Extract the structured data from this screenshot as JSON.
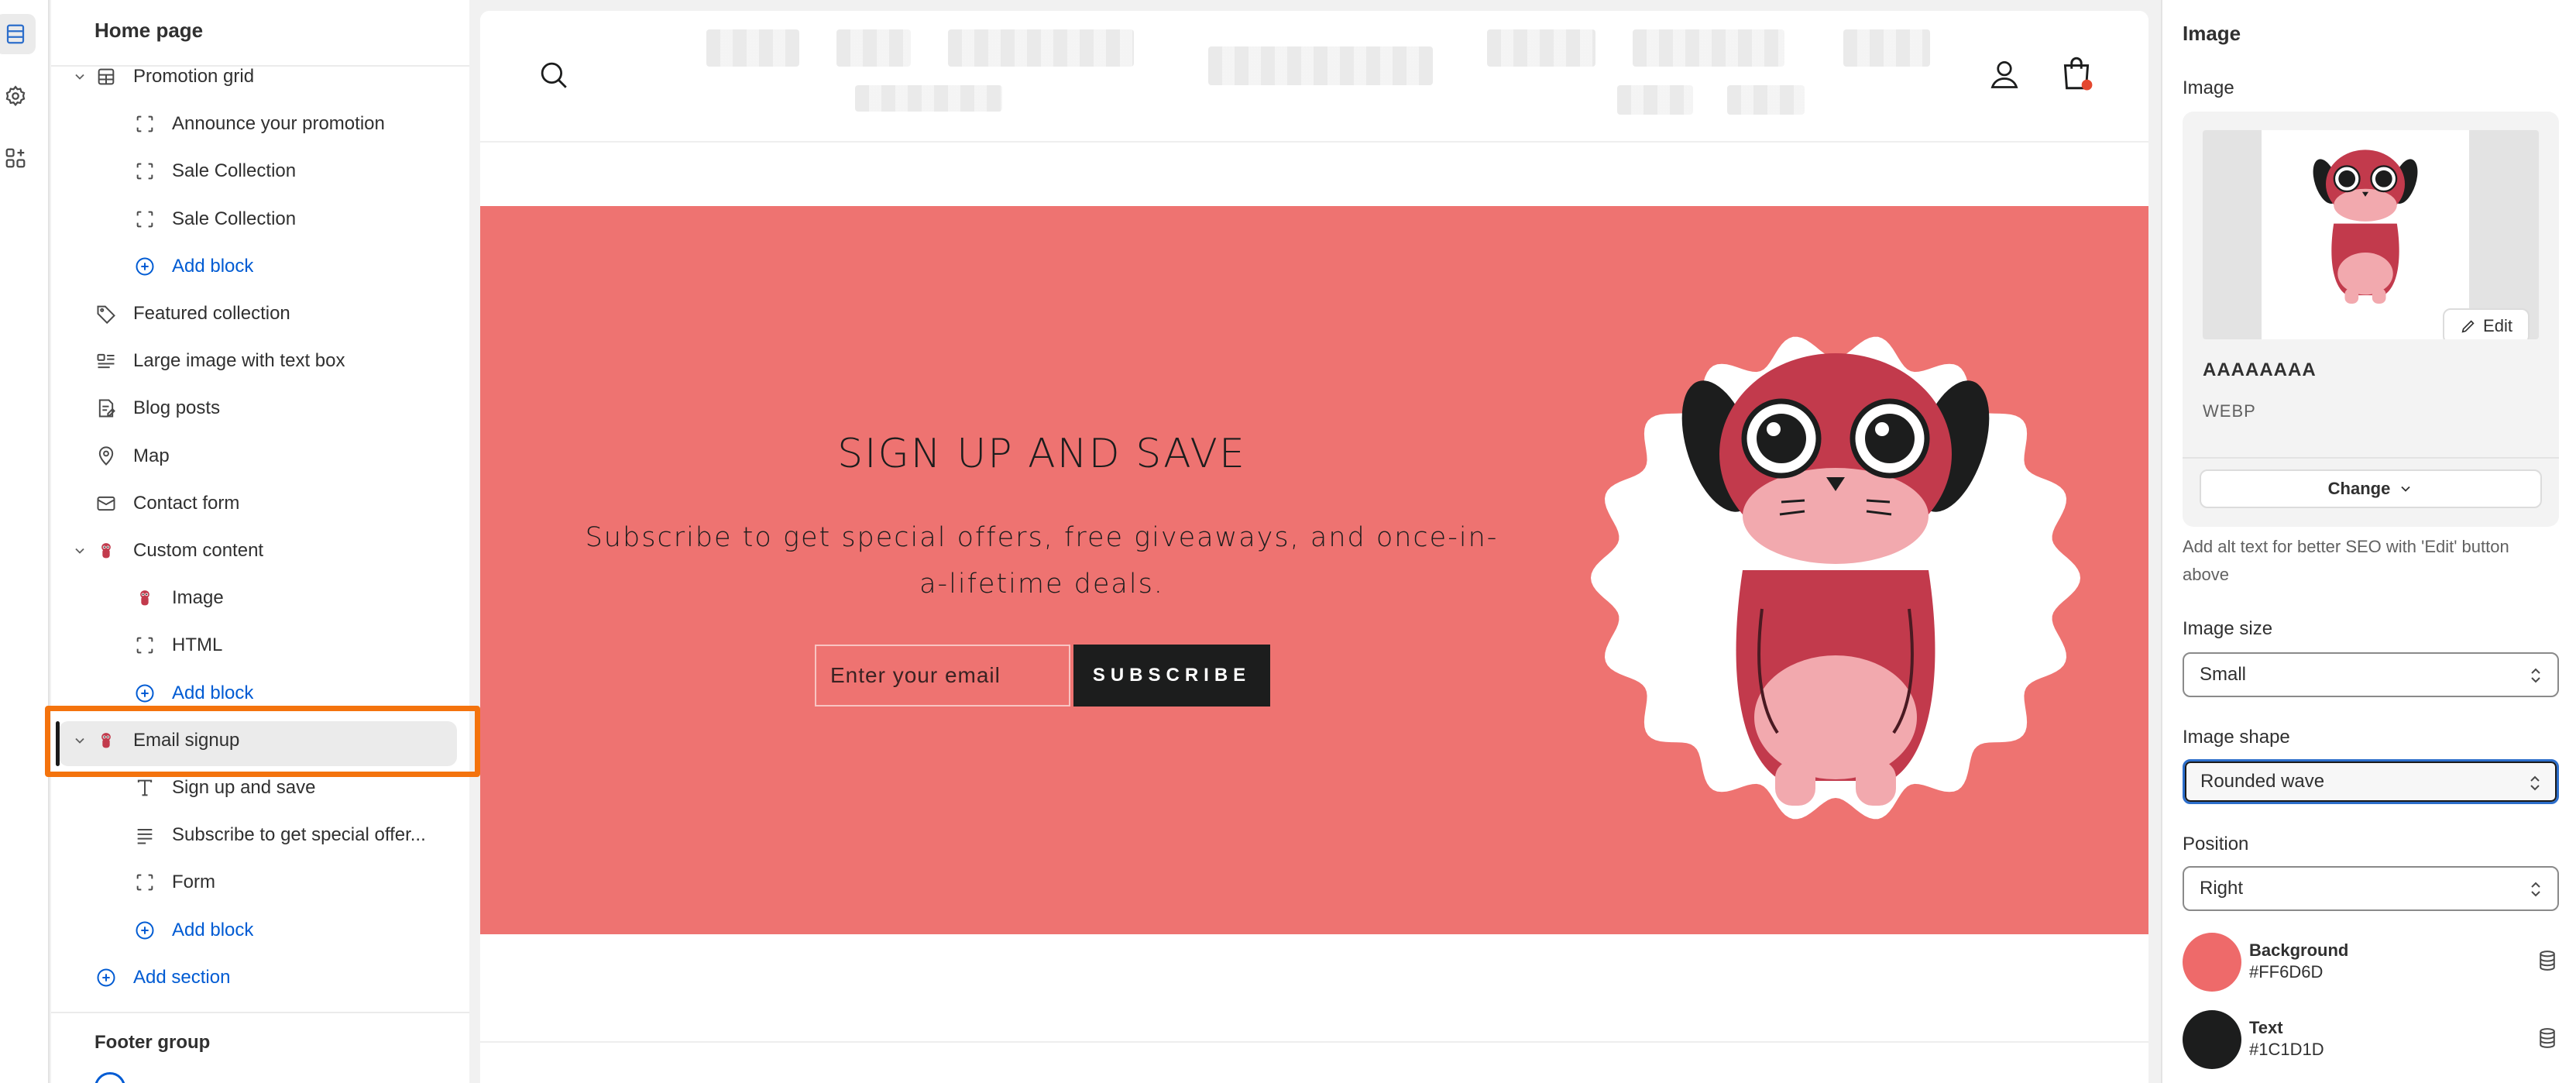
{
  "rail": {
    "items": [
      {
        "name": "sections-icon"
      },
      {
        "name": "settings-icon"
      },
      {
        "name": "apps-icon"
      }
    ]
  },
  "sidebar": {
    "title": "Home page",
    "tree": [
      {
        "label": "Promotion grid",
        "icon": "grid-icon",
        "level": 1,
        "expanded": true
      },
      {
        "label": "Announce your promotion",
        "icon": "block-icon",
        "level": 2
      },
      {
        "label": "Sale Collection",
        "icon": "block-icon",
        "level": 2
      },
      {
        "label": "Sale Collection",
        "icon": "block-icon",
        "level": 2
      },
      {
        "label": "Add block",
        "icon": "plus-circle-icon",
        "level": 2,
        "add": true
      },
      {
        "label": "Featured collection",
        "icon": "tag-icon",
        "level": 1
      },
      {
        "label": "Large image with text box",
        "icon": "image-text-icon",
        "level": 1
      },
      {
        "label": "Blog posts",
        "icon": "blog-icon",
        "level": 1
      },
      {
        "label": "Map",
        "icon": "map-pin-icon",
        "level": 1
      },
      {
        "label": "Contact form",
        "icon": "mail-icon",
        "level": 1
      },
      {
        "label": "Custom content",
        "icon": "app-plush-icon",
        "level": 1,
        "expanded": true
      },
      {
        "label": "Image",
        "icon": "app-plush-icon",
        "level": 2
      },
      {
        "label": "HTML",
        "icon": "block-icon",
        "level": 2
      },
      {
        "label": "Add block",
        "icon": "plus-circle-icon",
        "level": 2,
        "add": true
      },
      {
        "label": "Email signup",
        "icon": "app-plush-icon",
        "level": 1,
        "expanded": true,
        "selected": true
      },
      {
        "label": "Sign up and save",
        "icon": "text-icon",
        "level": 2
      },
      {
        "label": "Subscribe to get special offer...",
        "icon": "paragraph-icon",
        "level": 2
      },
      {
        "label": "Form",
        "icon": "block-icon",
        "level": 2
      },
      {
        "label": "Add block",
        "icon": "plus-circle-icon",
        "level": 2,
        "add": true
      },
      {
        "label": "Add section",
        "icon": "plus-circle-icon",
        "level": 1,
        "add": true
      }
    ],
    "footer_group": "Footer group"
  },
  "preview": {
    "header_icons": [
      "search-icon",
      "account-icon",
      "cart-icon"
    ],
    "signup_title": "SIGN UP AND SAVE",
    "signup_text": "Subscribe to get special offers, free giveaways, and once-in-a-lifetime deals.",
    "email_placeholder": "Enter your email",
    "subscribe_label": "SUBSCRIBE",
    "banner_color": "#EE7371"
  },
  "settings": {
    "title": "Image",
    "image_label": "Image",
    "edit_label": "Edit",
    "image_name": "AAAAAAAA",
    "image_type": "WEBP",
    "change_label": "Change",
    "alt_hint": "Add alt text for better SEO with 'Edit' button above",
    "image_size_label": "Image size",
    "image_size_value": "Small",
    "image_shape_label": "Image shape",
    "image_shape_value": "Rounded wave",
    "position_label": "Position",
    "position_value": "Right",
    "colors": [
      {
        "name": "Background",
        "value": "#FF6D6D",
        "swatch": "#EE6A6A"
      },
      {
        "name": "Text",
        "value": "#1C1D1D",
        "swatch": "#1C1D1D"
      }
    ]
  }
}
